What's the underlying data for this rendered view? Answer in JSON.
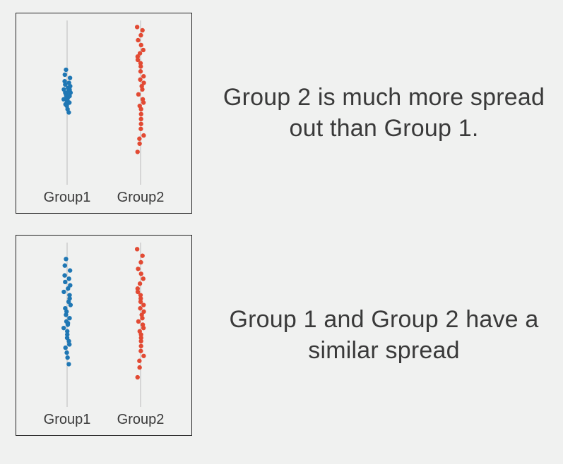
{
  "captions": {
    "top": "Group 2 is much more spread out than Group 1.",
    "bottom": "Group 1 and Group 2 have a similar spread"
  },
  "chart_data": [
    {
      "type": "scatter",
      "title": "",
      "xlabel": "",
      "ylabel": "",
      "categories": [
        "Group1",
        "Group2"
      ],
      "ylim": [
        0,
        100
      ],
      "series": [
        {
          "name": "Group1",
          "color": "#1f77b4",
          "values": [
            44,
            46,
            48,
            49,
            50,
            50,
            51,
            51,
            52,
            52,
            53,
            53,
            54,
            54,
            55,
            55,
            56,
            56,
            57,
            57,
            58,
            58,
            59,
            60,
            61,
            62,
            63,
            65,
            67,
            70
          ]
        },
        {
          "name": "Group2",
          "color": "#e24a33",
          "values": [
            20,
            25,
            28,
            30,
            34,
            37,
            40,
            43,
            46,
            48,
            50,
            52,
            55,
            58,
            60,
            62,
            64,
            66,
            69,
            72,
            74,
            76,
            78,
            80,
            82,
            85,
            88,
            91,
            94,
            96
          ]
        }
      ]
    },
    {
      "type": "scatter",
      "title": "",
      "xlabel": "",
      "ylabel": "",
      "categories": [
        "Group1",
        "Group2"
      ],
      "ylim": [
        0,
        100
      ],
      "series": [
        {
          "name": "Group1",
          "color": "#1f77b4",
          "values": [
            26,
            30,
            33,
            36,
            38,
            40,
            42,
            44,
            46,
            48,
            50,
            51,
            52,
            54,
            56,
            58,
            60,
            62,
            64,
            66,
            68,
            70,
            72,
            74,
            76,
            78,
            80,
            83,
            86,
            90
          ]
        },
        {
          "name": "Group2",
          "color": "#e24a33",
          "values": [
            18,
            24,
            28,
            31,
            34,
            37,
            40,
            42,
            44,
            46,
            48,
            50,
            52,
            54,
            56,
            58,
            60,
            62,
            64,
            66,
            68,
            70,
            72,
            75,
            78,
            81,
            84,
            88,
            92,
            96
          ]
        }
      ]
    }
  ]
}
